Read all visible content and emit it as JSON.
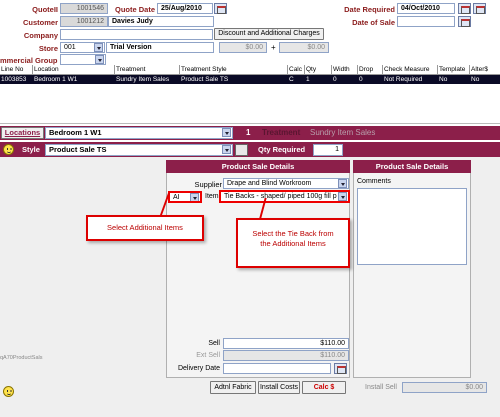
{
  "header": {
    "quote_label": "QuoteII",
    "quote_no": "1001546",
    "quote_date_label": "Quote Date",
    "quote_date": "25/Aug/2010",
    "customer_label": "Customer",
    "customer_no": "1001212",
    "customer_name": "Davies Judy",
    "company_label": "Company",
    "store_label": "Store",
    "store_code": "001",
    "store_name": "Trial Version",
    "discount_button": "Discount and Additional Charges",
    "discount_amount": "$0.00",
    "plus_sign": "+",
    "additional_amount": "$0.00",
    "commercial_group_label": "mmercial Group",
    "date_required_label": "Date Required",
    "date_required": "04/Oct/2010",
    "date_of_sale_label": "Date of Sale"
  },
  "table": {
    "columns": [
      "Line No",
      "Location",
      "Treatment",
      "Treatment Style",
      "Calc",
      "Qty",
      "Width",
      "Drop",
      "Check Measure",
      "Template",
      "Alter$"
    ],
    "rows": [
      [
        "1003853",
        "Bedroom 1 W1",
        "Sundry Item Sales",
        "Product Sale TS",
        "C",
        "1",
        "0",
        "0",
        "Not Required",
        "No",
        "No"
      ]
    ]
  },
  "locbar": {
    "locations_button": "Locations",
    "location_value": "Bedroom 1 W1",
    "line_number": "1",
    "treatment_label": "Treatment",
    "treatment_value": "Sundry Item Sales"
  },
  "stylebar": {
    "style_label": "Style",
    "style_value": "Product Sale TS",
    "qty_label": "Qty Required",
    "qty_value": "1"
  },
  "product_panel": {
    "title": "Product Sale Details",
    "supplier_label": "Supplier",
    "supplier_value": "Drape and Blind Workroom",
    "group_value": "AI",
    "item_label": "Item",
    "item_value": "Tie Backs - shaped/ piped 100g fill p",
    "sell_label": "Sell",
    "sell_value": "$110.00",
    "ext_sell_label": "Ext Sell",
    "ext_sell_value": "$110.00",
    "delivery_label": "Delivery Date"
  },
  "comments_panel": {
    "title": "Product Sale Details",
    "comments_label": "Comments"
  },
  "callouts": {
    "one": "Select Additional Items",
    "two": "Select the Tie Back from the Additional Items"
  },
  "footer": {
    "left_text": "qA70ProductSals",
    "adtnl_fabric": "Adtnl Fabric",
    "install_costs": "Install Costs",
    "calc": "Calc $",
    "install_sell_label": "Install Sell",
    "install_sell_value": "$0.00"
  }
}
